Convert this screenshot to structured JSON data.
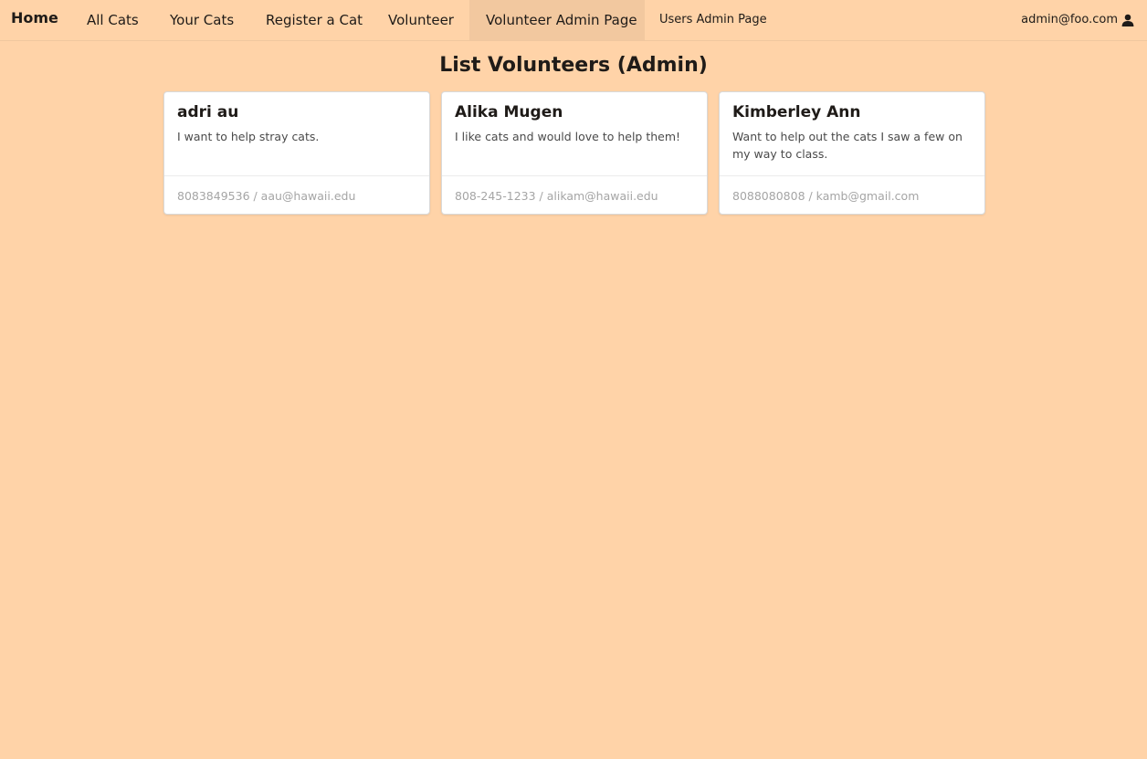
{
  "nav": {
    "brand": "Home",
    "items": [
      {
        "label": "All Cats"
      },
      {
        "label": "Your Cats"
      },
      {
        "label": "Register a Cat"
      },
      {
        "label": "Volunteer"
      },
      {
        "label": "Volunteer Admin Page"
      },
      {
        "label": "Users Admin Page"
      }
    ],
    "active_item": "Volunteer Admin Page",
    "user": {
      "label": "admin@foo.com",
      "icon": "user-icon"
    }
  },
  "page": {
    "title": "List Volunteers (Admin)"
  },
  "volunteers": [
    {
      "name": "adri au",
      "description": "I want to help stray cats.",
      "contact": "8083849536 / aau@hawaii.edu"
    },
    {
      "name": "Alika Mugen",
      "description": "I like cats and would love to help them!",
      "contact": "808-245-1233 / alikam@hawaii.edu"
    },
    {
      "name": "Kimberley Ann",
      "description": "Want to help out the cats I saw a few on my way to class.",
      "contact": "8088080808 / kamb@gmail.com"
    }
  ],
  "colors": {
    "background": "#ffd3a8",
    "active_nav": "#f2c89f",
    "card": "#ffffff",
    "footer_text": "#a5a5a5"
  }
}
